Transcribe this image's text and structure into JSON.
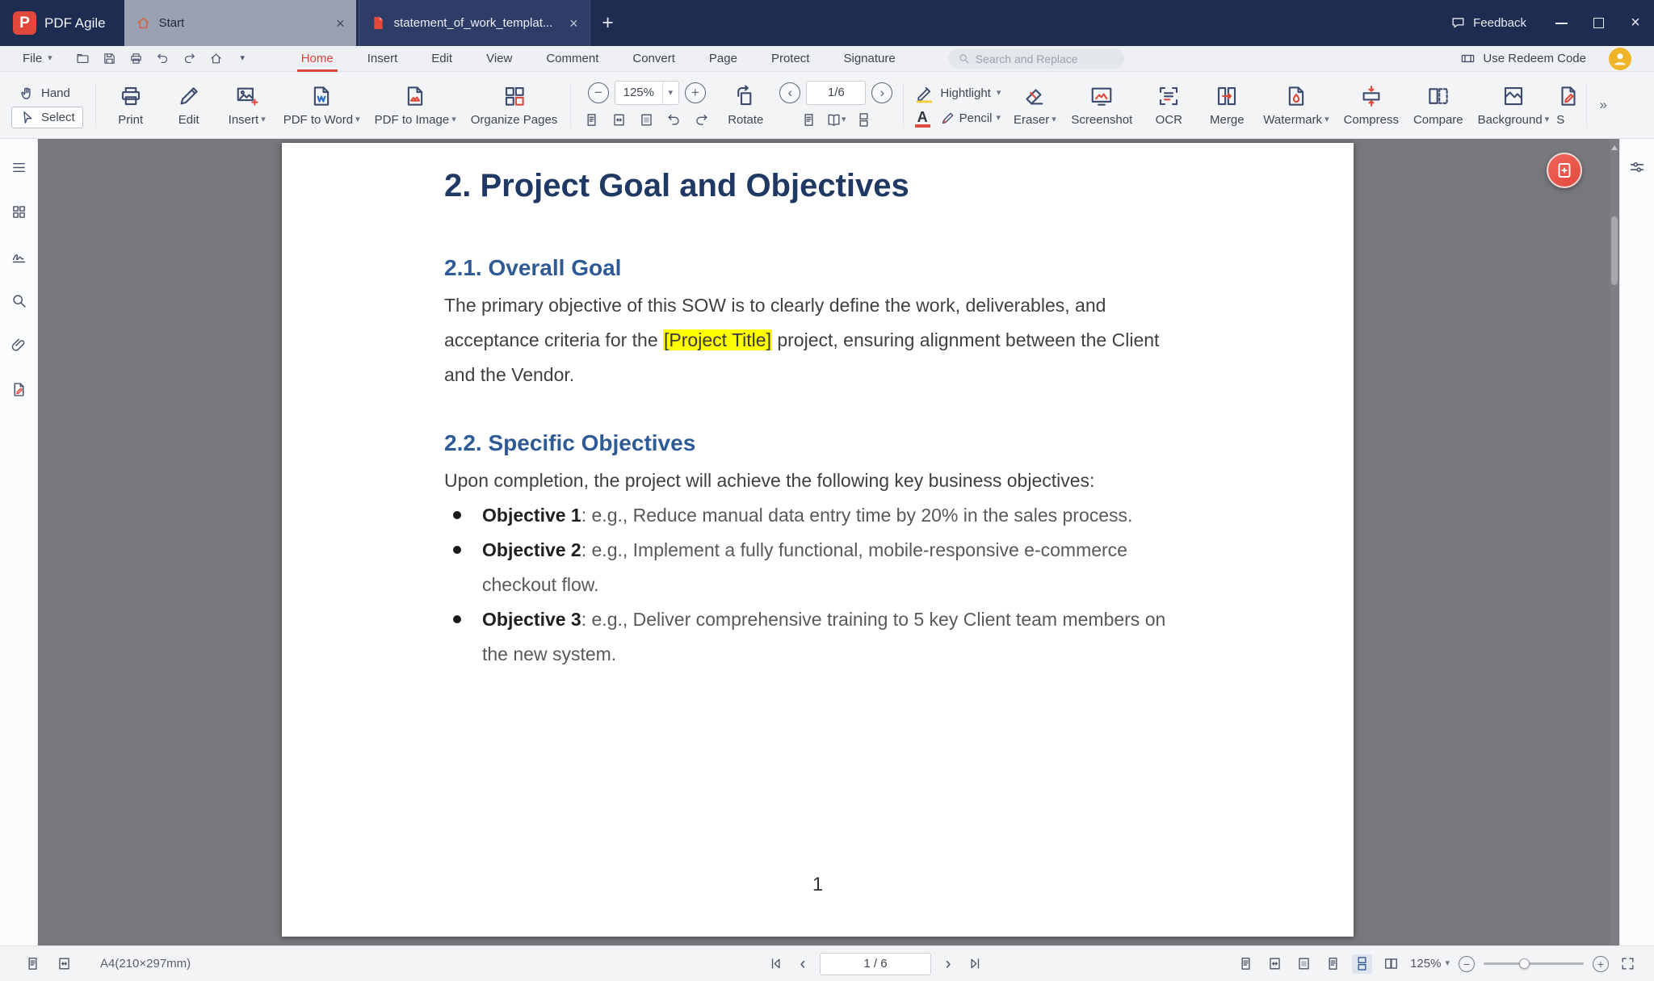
{
  "glyphs": {
    "chevron_down": "▾",
    "close": "×",
    "plus": "+",
    "minus": "−",
    "chevron_left": "‹",
    "chevron_right": "›",
    "double_chevron": "»"
  },
  "titlebar": {
    "app_name": "PDF Agile",
    "logo_glyph": "P",
    "tabs": [
      {
        "label": "Start"
      },
      {
        "label": "statement_of_work_templat..."
      }
    ],
    "feedback": "Feedback"
  },
  "menubar": {
    "file": "File",
    "items": [
      {
        "label": "Home"
      },
      {
        "label": "Insert"
      },
      {
        "label": "Edit"
      },
      {
        "label": "View"
      },
      {
        "label": "Comment"
      },
      {
        "label": "Convert"
      },
      {
        "label": "Page"
      },
      {
        "label": "Protect"
      },
      {
        "label": "Signature"
      }
    ],
    "search_placeholder": "Search and Replace",
    "redeem": "Use Redeem Code"
  },
  "toolbar": {
    "hand": "Hand",
    "select": "Select",
    "print": "Print",
    "edit": "Edit",
    "insert": "Insert",
    "pdf_to_word": "PDF to Word",
    "pdf_to_image": "PDF to Image",
    "organize_pages": "Organize Pages",
    "zoom_value": "125%",
    "page_value": "1/6",
    "rotate": "Rotate",
    "highlight": "Hightlight",
    "font_color_glyph": "A",
    "pencil": "Pencil",
    "eraser": "Eraser",
    "screenshot": "Screenshot",
    "ocr": "OCR",
    "merge": "Merge",
    "watermark": "Watermark",
    "compress": "Compress",
    "compare": "Compare",
    "background": "Background",
    "overflow_partial": "S"
  },
  "document": {
    "heading": "2. Project Goal and Objectives",
    "section1": {
      "title": "2.1. Overall Goal",
      "body_pre": "The primary objective of this SOW is to clearly define the work, deliverables, and acceptance criteria for the ",
      "highlight": "[Project Title]",
      "body_post": " project, ensuring alignment between the Client and the Vendor."
    },
    "section2": {
      "title": "2.2. Specific Objectives",
      "intro": "Upon completion, the project will achieve the following key business objectives:",
      "objectives": [
        {
          "label": "Objective 1",
          "text": ": e.g., Reduce manual data entry time by 20% in the sales process."
        },
        {
          "label": "Objective 2",
          "text": ": e.g., Implement a fully functional, mobile-responsive e-commerce checkout flow."
        },
        {
          "label": "Objective 3",
          "text": ": e.g., Deliver comprehensive training to 5 key Client team members on the new system."
        }
      ]
    },
    "page_number": "1"
  },
  "statusbar": {
    "page_size": "A4(210×297mm)",
    "page_indicator": "1 / 6",
    "zoom_value": "125%"
  }
}
